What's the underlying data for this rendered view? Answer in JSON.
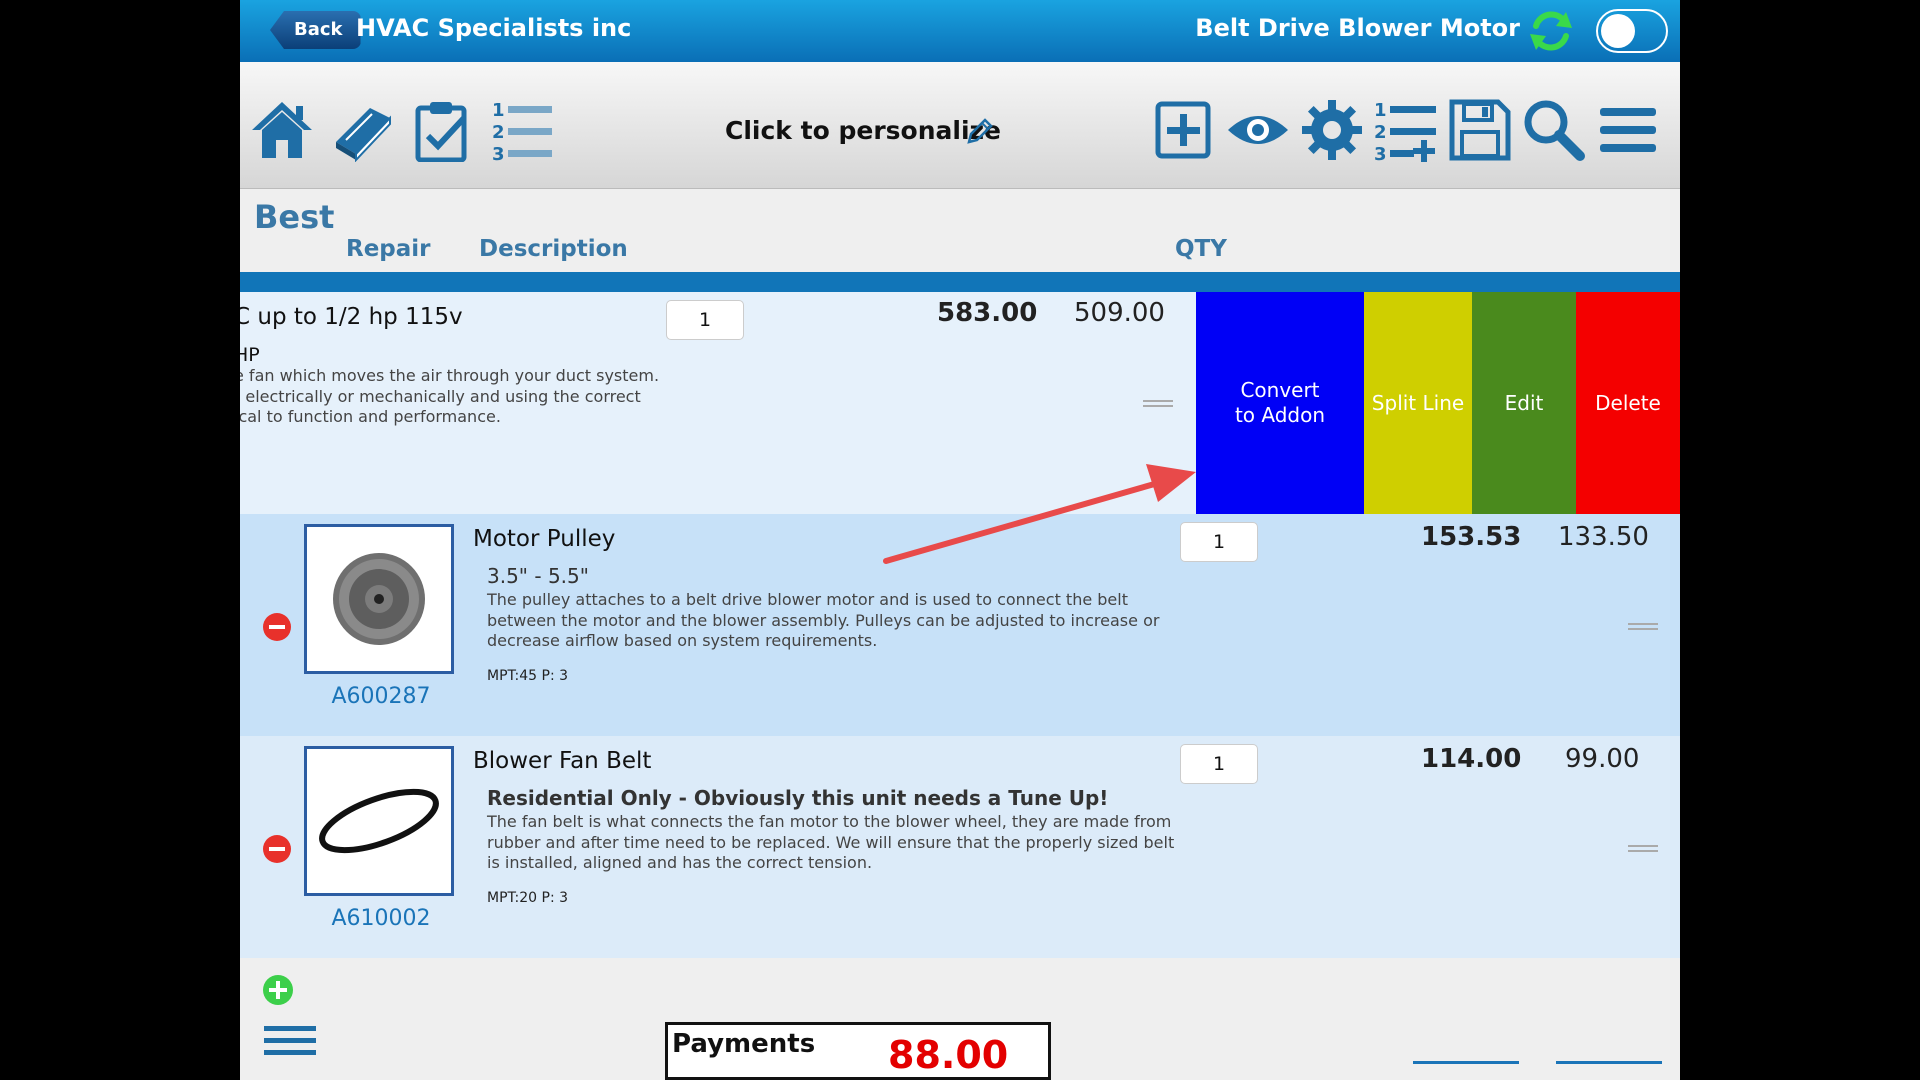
{
  "titlebar": {
    "back_label": "Back",
    "company": "HVAC Specialists inc",
    "record_title": "Belt Drive Blower Motor",
    "toggle_on": false
  },
  "toolbar": {
    "left_icons": [
      "home-icon",
      "book-icon",
      "clipboard-check-icon",
      "numbered-list-icon"
    ],
    "personalize_label": "Click to personalize",
    "right_icons": [
      "add-box-icon",
      "eye-icon",
      "gear-icon",
      "numbered-list-add-icon",
      "save-icon",
      "search-icon",
      "hamburger-menu-icon"
    ]
  },
  "tier": {
    "label": "Best",
    "columns": {
      "repair": "Repair",
      "description": "Description",
      "qty": "QTY"
    }
  },
  "rows": [
    {
      "title": "C up to 1/2 hp 115v",
      "subtitle": "HP",
      "description": [
        "e fan which moves the air through your duct system.",
        "t electrically or mechanically and using the correct",
        "ical to function and performance."
      ],
      "qty": "1",
      "price_1": "583.00",
      "price_2": "509.00",
      "swipe_actions": {
        "convert": "Convert\nto Addon",
        "split": "Split Line",
        "edit": "Edit",
        "delete": "Delete"
      }
    },
    {
      "name": "Motor Pulley",
      "part_no": "A600287",
      "subtitle": "3.5\" - 5.5\"",
      "description": "The pulley attaches to a belt drive blower motor and is used to connect the belt between the motor and the blower assembly. Pulleys can be adjusted to increase or decrease airflow based on system requirements.",
      "meta": "MPT:45 P: 3",
      "qty": "1",
      "price_1": "153.53",
      "price_2": "133.50"
    },
    {
      "name": "Blower Fan Belt",
      "part_no": "A610002",
      "subtitle": "Residential Only - Obviously this unit needs a Tune Up!",
      "description": "The fan belt is what connects the fan motor to the blower wheel, they are made from rubber and after time need to be replaced. We will ensure that the properly sized belt is installed, aligned and has the correct tension.",
      "meta": "MPT:20 P: 3",
      "qty": "1",
      "price_1": "114.00",
      "price_2": "99.00"
    }
  ],
  "footer": {
    "payments_label": "Payments",
    "payments_value": "88.00"
  },
  "colors": {
    "titlebar": "#0a6fb6",
    "accent_blue": "#1175b8",
    "convert": "#0000f6",
    "split": "#cfcf00",
    "edit": "#4a8a1d",
    "delete": "#f40000",
    "annotation_arrow": "#e84a4a"
  }
}
